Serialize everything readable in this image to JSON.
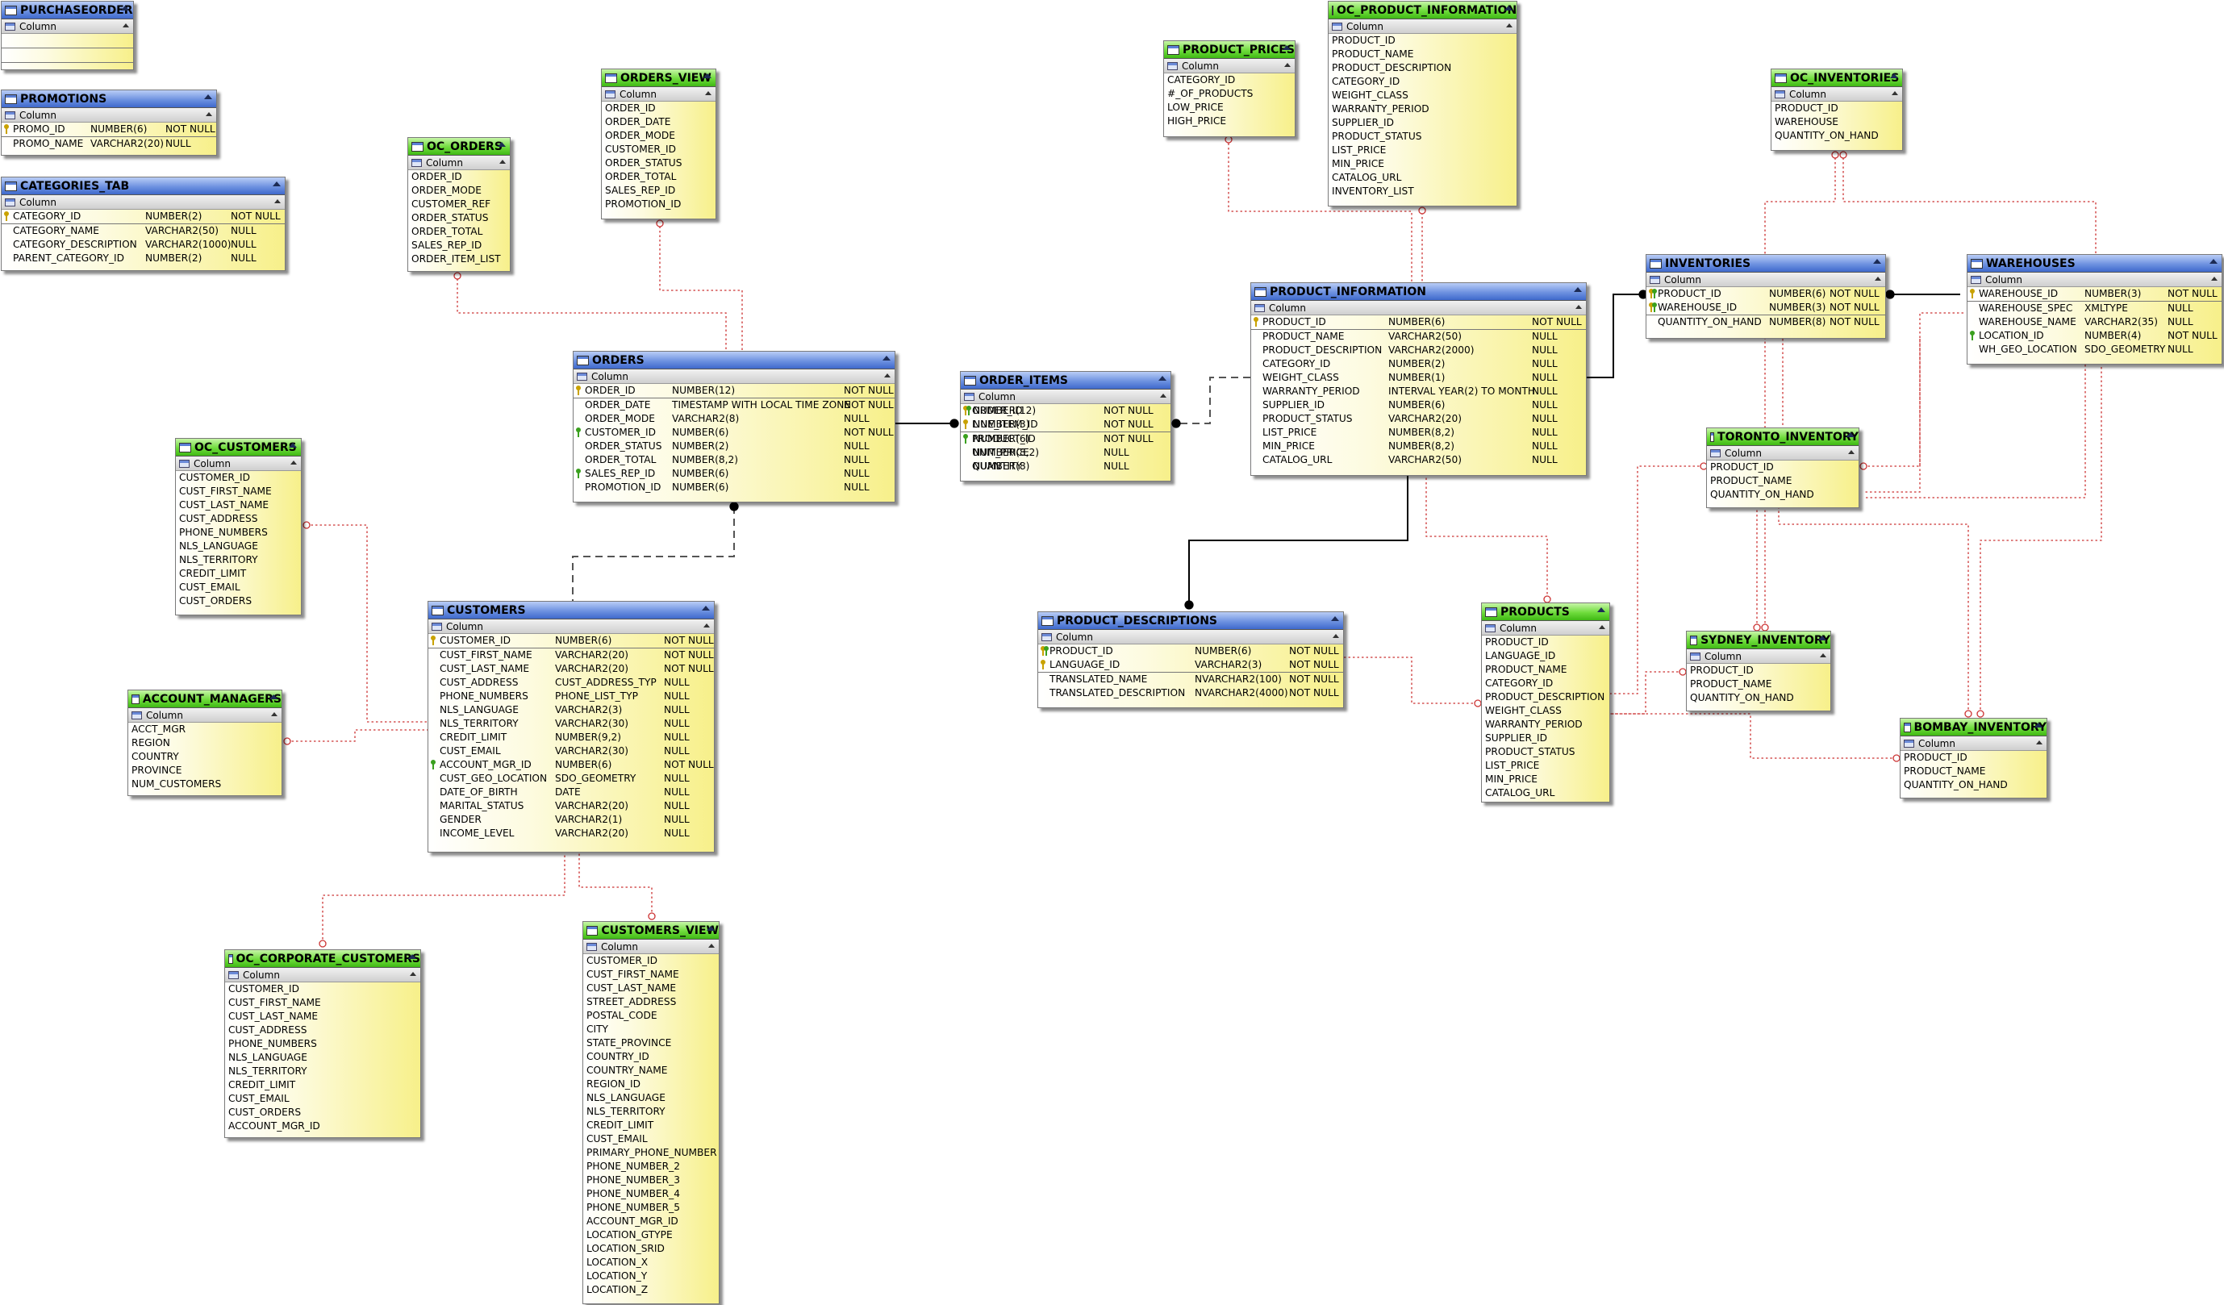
{
  "labels": {
    "column": "Column"
  },
  "entities": [
    {
      "name": "PURCHASEORDER",
      "kind": "table",
      "cols": [],
      "rows": []
    },
    {
      "name": "PROMOTIONS",
      "kind": "table",
      "rows": [
        [
          "PROMO_ID",
          "NUMBER(6)",
          "NOT NULL",
          "pk",
          true
        ],
        [
          "PROMO_NAME",
          "VARCHAR2(20)",
          "NULL",
          "",
          false
        ]
      ]
    },
    {
      "name": "CATEGORIES_TAB",
      "kind": "table",
      "rows": [
        [
          "CATEGORY_ID",
          "NUMBER(2)",
          "NOT NULL",
          "pk",
          true
        ],
        [
          "CATEGORY_NAME",
          "VARCHAR2(50)",
          "NULL",
          "",
          false
        ],
        [
          "CATEGORY_DESCRIPTION",
          "VARCHAR2(1000)",
          "NULL",
          "",
          false
        ],
        [
          "PARENT_CATEGORY_ID",
          "NUMBER(2)",
          "NULL",
          "",
          false
        ]
      ]
    },
    {
      "name": "OC_ORDERS",
      "kind": "view",
      "rows": [
        [
          "ORDER_ID"
        ],
        [
          "ORDER_MODE"
        ],
        [
          "CUSTOMER_REF"
        ],
        [
          "ORDER_STATUS"
        ],
        [
          "ORDER_TOTAL"
        ],
        [
          "SALES_REP_ID"
        ],
        [
          "ORDER_ITEM_LIST"
        ]
      ]
    },
    {
      "name": "ORDERS_VIEW",
      "kind": "view",
      "rows": [
        [
          "ORDER_ID"
        ],
        [
          "ORDER_DATE"
        ],
        [
          "ORDER_MODE"
        ],
        [
          "CUSTOMER_ID"
        ],
        [
          "ORDER_STATUS"
        ],
        [
          "ORDER_TOTAL"
        ],
        [
          "SALES_REP_ID"
        ],
        [
          "PROMOTION_ID"
        ]
      ]
    },
    {
      "name": "ORDERS",
      "kind": "table",
      "rows": [
        [
          "ORDER_ID",
          "NUMBER(12)",
          "NOT NULL",
          "pk",
          true
        ],
        [
          "ORDER_DATE",
          "TIMESTAMP WITH LOCAL TIME ZONE",
          "NOT NULL",
          "",
          false
        ],
        [
          "ORDER_MODE",
          "VARCHAR2(8)",
          "NULL",
          "",
          false
        ],
        [
          "CUSTOMER_ID",
          "NUMBER(6)",
          "NOT NULL",
          "fk",
          false
        ],
        [
          "ORDER_STATUS",
          "NUMBER(2)",
          "NULL",
          "",
          false
        ],
        [
          "ORDER_TOTAL",
          "NUMBER(8,2)",
          "NULL",
          "",
          false
        ],
        [
          "SALES_REP_ID",
          "NUMBER(6)",
          "NULL",
          "fk",
          false
        ],
        [
          "PROMOTION_ID",
          "NUMBER(6)",
          "NULL",
          "",
          false
        ]
      ]
    },
    {
      "name": "ORDER_ITEMS",
      "kind": "table",
      "rows": [
        [
          "ORDER_ID",
          "NUMBER(12)",
          "NOT NULL",
          "pkfk",
          false
        ],
        [
          "LINE_ITEM_ID",
          "NUMBER(3)",
          "NOT NULL",
          "pk",
          true
        ],
        [
          "PRODUCT_ID",
          "NUMBER(6)",
          "NOT NULL",
          "fk",
          false
        ],
        [
          "UNIT_PRICE",
          "NUMBER(8,2)",
          "NULL",
          "",
          false
        ],
        [
          "QUANTITY",
          "NUMBER(8)",
          "NULL",
          "",
          false
        ]
      ]
    },
    {
      "name": "PRODUCT_PRICES",
      "kind": "view",
      "rows": [
        [
          "CATEGORY_ID"
        ],
        [
          "#_OF_PRODUCTS"
        ],
        [
          "LOW_PRICE"
        ],
        [
          "HIGH_PRICE"
        ]
      ]
    },
    {
      "name": "OC_PRODUCT_INFORMATION",
      "kind": "view",
      "rows": [
        [
          "PRODUCT_ID"
        ],
        [
          "PRODUCT_NAME"
        ],
        [
          "PRODUCT_DESCRIPTION"
        ],
        [
          "CATEGORY_ID"
        ],
        [
          "WEIGHT_CLASS"
        ],
        [
          "WARRANTY_PERIOD"
        ],
        [
          "SUPPLIER_ID"
        ],
        [
          "PRODUCT_STATUS"
        ],
        [
          "LIST_PRICE"
        ],
        [
          "MIN_PRICE"
        ],
        [
          "CATALOG_URL"
        ],
        [
          "INVENTORY_LIST"
        ]
      ]
    },
    {
      "name": "PRODUCT_INFORMATION",
      "kind": "table",
      "rows": [
        [
          "PRODUCT_ID",
          "NUMBER(6)",
          "NOT NULL",
          "pk",
          true
        ],
        [
          "PRODUCT_NAME",
          "VARCHAR2(50)",
          "NULL",
          "",
          false
        ],
        [
          "PRODUCT_DESCRIPTION",
          "VARCHAR2(2000)",
          "NULL",
          "",
          false
        ],
        [
          "CATEGORY_ID",
          "NUMBER(2)",
          "NULL",
          "",
          false
        ],
        [
          "WEIGHT_CLASS",
          "NUMBER(1)",
          "NULL",
          "",
          false
        ],
        [
          "WARRANTY_PERIOD",
          "INTERVAL YEAR(2) TO MONTH",
          "NULL",
          "",
          false
        ],
        [
          "SUPPLIER_ID",
          "NUMBER(6)",
          "NULL",
          "",
          false
        ],
        [
          "PRODUCT_STATUS",
          "VARCHAR2(20)",
          "NULL",
          "",
          false
        ],
        [
          "LIST_PRICE",
          "NUMBER(8,2)",
          "NULL",
          "",
          false
        ],
        [
          "MIN_PRICE",
          "NUMBER(8,2)",
          "NULL",
          "",
          false
        ],
        [
          "CATALOG_URL",
          "VARCHAR2(50)",
          "NULL",
          "",
          false
        ]
      ]
    },
    {
      "name": "OC_INVENTORIES",
      "kind": "view",
      "rows": [
        [
          "PRODUCT_ID"
        ],
        [
          "WAREHOUSE"
        ],
        [
          "QUANTITY_ON_HAND"
        ]
      ]
    },
    {
      "name": "INVENTORIES",
      "kind": "table",
      "rows": [
        [
          "PRODUCT_ID",
          "NUMBER(6)",
          "NOT NULL",
          "pkfk",
          false
        ],
        [
          "WAREHOUSE_ID",
          "NUMBER(3)",
          "NOT NULL",
          "pkfk",
          true
        ],
        [
          "QUANTITY_ON_HAND",
          "NUMBER(8)",
          "NOT NULL",
          "",
          false
        ]
      ]
    },
    {
      "name": "WAREHOUSES",
      "kind": "table",
      "rows": [
        [
          "WAREHOUSE_ID",
          "NUMBER(3)",
          "NOT NULL",
          "pk",
          true
        ],
        [
          "WAREHOUSE_SPEC",
          "XMLTYPE",
          "NULL",
          "",
          false
        ],
        [
          "WAREHOUSE_NAME",
          "VARCHAR2(35)",
          "NULL",
          "",
          false
        ],
        [
          "LOCATION_ID",
          "NUMBER(4)",
          "NOT NULL",
          "fk",
          false
        ],
        [
          "WH_GEO_LOCATION",
          "SDO_GEOMETRY",
          "NULL",
          "",
          false
        ]
      ]
    },
    {
      "name": "TORONTO_INVENTORY",
      "kind": "view",
      "rows": [
        [
          "PRODUCT_ID"
        ],
        [
          "PRODUCT_NAME"
        ],
        [
          "QUANTITY_ON_HAND"
        ]
      ]
    },
    {
      "name": "OC_CUSTOMERS",
      "kind": "view",
      "rows": [
        [
          "CUSTOMER_ID"
        ],
        [
          "CUST_FIRST_NAME"
        ],
        [
          "CUST_LAST_NAME"
        ],
        [
          "CUST_ADDRESS"
        ],
        [
          "PHONE_NUMBERS"
        ],
        [
          "NLS_LANGUAGE"
        ],
        [
          "NLS_TERRITORY"
        ],
        [
          "CREDIT_LIMIT"
        ],
        [
          "CUST_EMAIL"
        ],
        [
          "CUST_ORDERS"
        ]
      ]
    },
    {
      "name": "CUSTOMERS",
      "kind": "table",
      "rows": [
        [
          "CUSTOMER_ID",
          "NUMBER(6)",
          "NOT NULL",
          "pk",
          true
        ],
        [
          "CUST_FIRST_NAME",
          "VARCHAR2(20)",
          "NOT NULL",
          "",
          false
        ],
        [
          "CUST_LAST_NAME",
          "VARCHAR2(20)",
          "NOT NULL",
          "",
          false
        ],
        [
          "CUST_ADDRESS",
          "CUST_ADDRESS_TYP",
          "NULL",
          "",
          false
        ],
        [
          "PHONE_NUMBERS",
          "PHONE_LIST_TYP",
          "NULL",
          "",
          false
        ],
        [
          "NLS_LANGUAGE",
          "VARCHAR2(3)",
          "NULL",
          "",
          false
        ],
        [
          "NLS_TERRITORY",
          "VARCHAR2(30)",
          "NULL",
          "",
          false
        ],
        [
          "CREDIT_LIMIT",
          "NUMBER(9,2)",
          "NULL",
          "",
          false
        ],
        [
          "CUST_EMAIL",
          "VARCHAR2(30)",
          "NULL",
          "",
          false
        ],
        [
          "ACCOUNT_MGR_ID",
          "NUMBER(6)",
          "NOT NULL",
          "fk",
          false
        ],
        [
          "CUST_GEO_LOCATION",
          "SDO_GEOMETRY",
          "NULL",
          "",
          false
        ],
        [
          "DATE_OF_BIRTH",
          "DATE",
          "NULL",
          "",
          false
        ],
        [
          "MARITAL_STATUS",
          "VARCHAR2(20)",
          "NULL",
          "",
          false
        ],
        [
          "GENDER",
          "VARCHAR2(1)",
          "NULL",
          "",
          false
        ],
        [
          "INCOME_LEVEL",
          "VARCHAR2(20)",
          "NULL",
          "",
          false
        ]
      ]
    },
    {
      "name": "ACCOUNT_MANAGERS",
      "kind": "view",
      "rows": [
        [
          "ACCT_MGR"
        ],
        [
          "REGION"
        ],
        [
          "COUNTRY"
        ],
        [
          "PROVINCE"
        ],
        [
          "NUM_CUSTOMERS"
        ]
      ]
    },
    {
      "name": "PRODUCT_DESCRIPTIONS",
      "kind": "table",
      "rows": [
        [
          "PRODUCT_ID",
          "NUMBER(6)",
          "NOT NULL",
          "pkfk",
          false
        ],
        [
          "LANGUAGE_ID",
          "VARCHAR2(3)",
          "NOT NULL",
          "pk",
          true
        ],
        [
          "TRANSLATED_NAME",
          "NVARCHAR2(100)",
          "NOT NULL",
          "",
          false
        ],
        [
          "TRANSLATED_DESCRIPTION",
          "NVARCHAR2(4000)",
          "NOT NULL",
          "",
          false
        ]
      ]
    },
    {
      "name": "PRODUCTS",
      "kind": "view",
      "rows": [
        [
          "PRODUCT_ID"
        ],
        [
          "LANGUAGE_ID"
        ],
        [
          "PRODUCT_NAME"
        ],
        [
          "CATEGORY_ID"
        ],
        [
          "PRODUCT_DESCRIPTION"
        ],
        [
          "WEIGHT_CLASS"
        ],
        [
          "WARRANTY_PERIOD"
        ],
        [
          "SUPPLIER_ID"
        ],
        [
          "PRODUCT_STATUS"
        ],
        [
          "LIST_PRICE"
        ],
        [
          "MIN_PRICE"
        ],
        [
          "CATALOG_URL"
        ]
      ]
    },
    {
      "name": "SYDNEY_INVENTORY",
      "kind": "view",
      "rows": [
        [
          "PRODUCT_ID"
        ],
        [
          "PRODUCT_NAME"
        ],
        [
          "QUANTITY_ON_HAND"
        ]
      ]
    },
    {
      "name": "BOMBAY_INVENTORY",
      "kind": "view",
      "rows": [
        [
          "PRODUCT_ID"
        ],
        [
          "PRODUCT_NAME"
        ],
        [
          "QUANTITY_ON_HAND"
        ]
      ]
    },
    {
      "name": "OC_CORPORATE_CUSTOMERS",
      "kind": "view",
      "rows": [
        [
          "CUSTOMER_ID"
        ],
        [
          "CUST_FIRST_NAME"
        ],
        [
          "CUST_LAST_NAME"
        ],
        [
          "CUST_ADDRESS"
        ],
        [
          "PHONE_NUMBERS"
        ],
        [
          "NLS_LANGUAGE"
        ],
        [
          "NLS_TERRITORY"
        ],
        [
          "CREDIT_LIMIT"
        ],
        [
          "CUST_EMAIL"
        ],
        [
          "CUST_ORDERS"
        ],
        [
          "ACCOUNT_MGR_ID"
        ]
      ]
    },
    {
      "name": "CUSTOMERS_VIEW",
      "kind": "view",
      "rows": [
        [
          "CUSTOMER_ID"
        ],
        [
          "CUST_FIRST_NAME"
        ],
        [
          "CUST_LAST_NAME"
        ],
        [
          "STREET_ADDRESS"
        ],
        [
          "POSTAL_CODE"
        ],
        [
          "CITY"
        ],
        [
          "STATE_PROVINCE"
        ],
        [
          "COUNTRY_ID"
        ],
        [
          "COUNTRY_NAME"
        ],
        [
          "REGION_ID"
        ],
        [
          "NLS_LANGUAGE"
        ],
        [
          "NLS_TERRITORY"
        ],
        [
          "CREDIT_LIMIT"
        ],
        [
          "CUST_EMAIL"
        ],
        [
          "PRIMARY_PHONE_NUMBER"
        ],
        [
          "PHONE_NUMBER_2"
        ],
        [
          "PHONE_NUMBER_3"
        ],
        [
          "PHONE_NUMBER_4"
        ],
        [
          "PHONE_NUMBER_5"
        ],
        [
          "ACCOUNT_MGR_ID"
        ],
        [
          "LOCATION_GTYPE"
        ],
        [
          "LOCATION_SRID"
        ],
        [
          "LOCATION_X"
        ],
        [
          "LOCATION_Y"
        ],
        [
          "LOCATION_Z"
        ]
      ]
    }
  ],
  "colors": {
    "key_pk": "#c9a200",
    "key_fk": "#3aa01e",
    "link_solid": "#000000",
    "link_dotted": "#cc3333",
    "link_dashed": "#555555"
  }
}
